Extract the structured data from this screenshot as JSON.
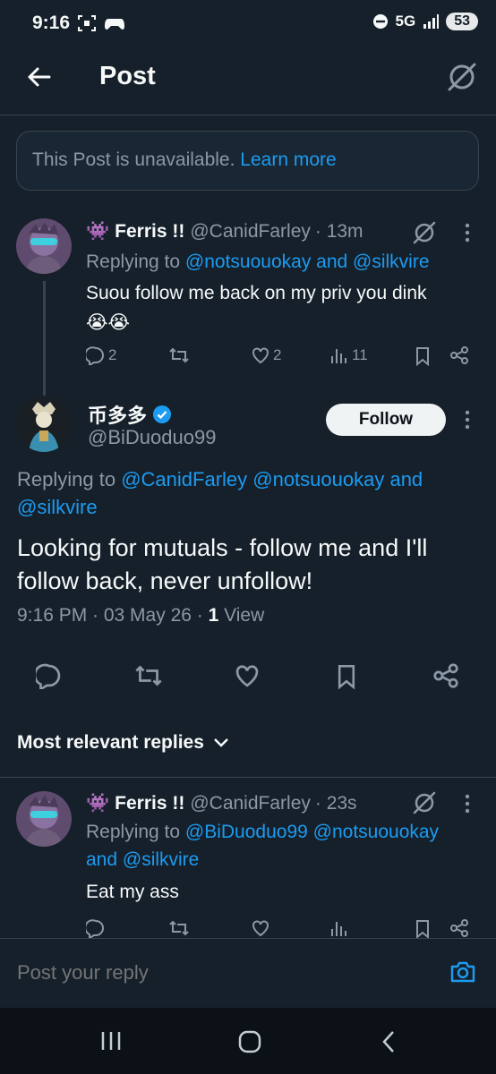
{
  "status_bar": {
    "time": "9:16",
    "network": "5G",
    "battery": "53"
  },
  "header": {
    "title": "Post"
  },
  "unavailable": {
    "text": "This Post is unavailable.",
    "link": "Learn more"
  },
  "reply1": {
    "emoji": "👾",
    "name": "Ferris !!",
    "handle": "@CanidFarley",
    "time": "· 13m",
    "replying_prefix": "Replying to",
    "replying_to": "@notsuouokay and @silkvire",
    "text": "Suou follow me back on my priv you dink",
    "emoji_text": "😭😭",
    "replies": "2",
    "reposts": "",
    "likes": "2",
    "views": "11"
  },
  "main": {
    "name": "币多多",
    "handle": "@BiDuoduo99",
    "follow_label": "Follow",
    "replying_prefix": "Replying to",
    "replying_to_1": "@CanidFarley @notsuouokay and",
    "replying_to_2": "@silkvire",
    "text": "Looking for mutuals - follow me and I'll follow back, never unfollow!",
    "meta_time": "9:16 PM · 03 May 26 · ",
    "views_count": "1",
    "views_label": " View"
  },
  "sort": {
    "label": "Most relevant replies"
  },
  "reply2": {
    "emoji": "👾",
    "name": "Ferris !!",
    "handle": "@CanidFarley",
    "time": "· 23s",
    "replying_prefix": "Replying to",
    "replying_to_1": "@BiDuoduo99 @notsuouokay",
    "replying_to_2": "and @silkvire",
    "text": "Eat my ass"
  },
  "compose": {
    "placeholder": "Post your reply"
  },
  "colors": {
    "background": "#15202b",
    "accent": "#1d9bf0",
    "muted": "#8b98a5",
    "border": "#38444d"
  }
}
